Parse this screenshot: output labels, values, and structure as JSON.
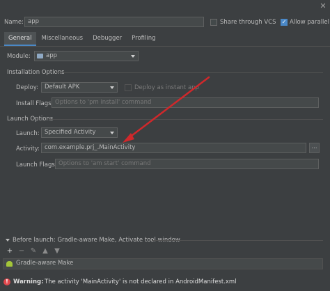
{
  "header": {
    "name_label": "Name:",
    "name_value": "app",
    "share_vcs_label": "Share through VCS",
    "allow_parallel_label": "Allow parallel run",
    "close_icon": "close-icon"
  },
  "tabs": [
    {
      "label": "General",
      "active": true
    },
    {
      "label": "Miscellaneous",
      "active": false
    },
    {
      "label": "Debugger",
      "active": false
    },
    {
      "label": "Profiling",
      "active": false
    }
  ],
  "module": {
    "label": "Module:",
    "value": "app",
    "icon": "module-folder-icon"
  },
  "installation": {
    "title": "Installation Options",
    "deploy_label": "Deploy:",
    "deploy_value": "Default APK",
    "instant_app_label": "Deploy as instant app",
    "install_flags_label": "Install Flags:",
    "install_flags_placeholder": "Options to 'pm install' command"
  },
  "launch": {
    "title": "Launch Options",
    "launch_label": "Launch:",
    "launch_value": "Specified Activity",
    "activity_label": "Activity:",
    "activity_value": "com.example.prj_.MainActivity",
    "browse_label": "...",
    "launch_flags_label": "Launch Flags:",
    "launch_flags_placeholder": "Options to 'am start' command"
  },
  "before_launch": {
    "title": "Before launch: Gradle-aware Make, Activate tool window",
    "toolbar": [
      "+",
      "−",
      "✎",
      "▲",
      "▼"
    ],
    "items": [
      {
        "label": "Gradle-aware Make",
        "icon": "android-icon"
      }
    ]
  },
  "warning": {
    "prefix": "Warning:",
    "message": "The activity 'MainActivity' is not declared in AndroidManifest.xml",
    "icon": "error-icon"
  },
  "colors": {
    "background": "#3c3f41",
    "accent": "#4a88c7",
    "annotation_arrow": "#d0282b",
    "warning_icon": "#e0474c"
  }
}
